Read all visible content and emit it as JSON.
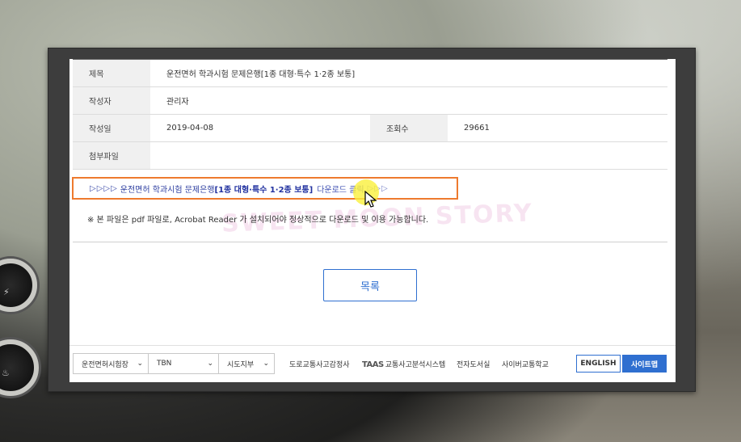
{
  "post": {
    "title_label": "제목",
    "title_value": "운전면허 학과시험 문제은행[1종 대형·특수 1·2종 보통]",
    "author_label": "작성자",
    "author_value": "관리자",
    "date_label": "작성일",
    "date_value": "2019-04-08",
    "views_label": "조회수",
    "views_value": "29661",
    "attach_label": "첨부파일",
    "attach_value": ""
  },
  "download": {
    "arrows_left": "▷▷▷▷",
    "title_plain": "운전면허 학과시험 문제은행",
    "title_bold": "[1종 대형·특수 1·2종 보통]",
    "link_text": "다운로드 클릭",
    "arrows_right": "▷▷▷"
  },
  "note": "※ 본 파일은 pdf 파일로, Acrobat Reader 가 설치되어야 정상적으로 다운로드 및 이용 가능합니다.",
  "watermark": "SWEET MOON STORY",
  "list_button": "목록",
  "footer": {
    "select_1": "운전면허시험장",
    "select_2": "TBN",
    "select_3": "시도지부",
    "links": [
      "도로교통사고감정사",
      "교통사고분석시스템",
      "전자도서실",
      "사이버교통학교"
    ],
    "taas_logo": "TAAS",
    "english_button": "ENGLISH",
    "sitemap_button": "사이트맵"
  },
  "colors": {
    "accent_blue": "#2f6fd0",
    "highlight_orange": "#ee7a2e",
    "link_navy": "#2232a0"
  }
}
